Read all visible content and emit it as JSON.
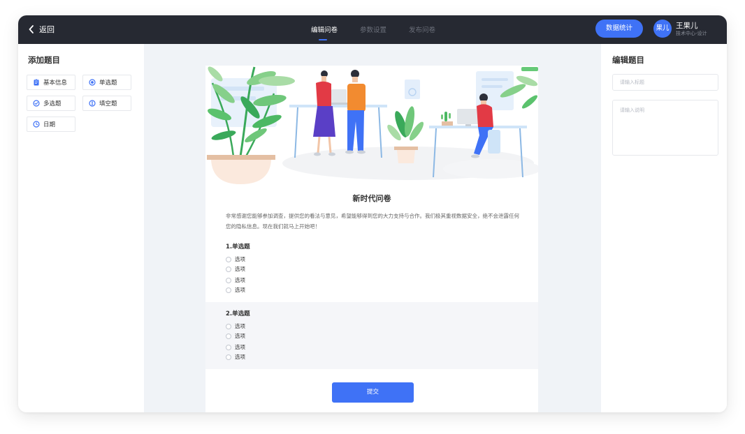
{
  "topbar": {
    "back_label": "返回",
    "tabs": [
      {
        "label": "编辑问卷",
        "active": true
      },
      {
        "label": "参数设置",
        "active": false
      },
      {
        "label": "发布问卷",
        "active": false
      }
    ],
    "stats_button": "数据统计",
    "user": {
      "avatar_text": "果儿",
      "name": "王果儿",
      "dept": "技术中心-设计"
    }
  },
  "left_panel": {
    "title": "添加题目",
    "items": [
      {
        "label": "基本信息",
        "icon": "clipboard-icon"
      },
      {
        "label": "单选题",
        "icon": "radio-icon"
      },
      {
        "label": "多选题",
        "icon": "check-circle-icon"
      },
      {
        "label": "填空题",
        "icon": "text-input-icon"
      },
      {
        "label": "日期",
        "icon": "clock-icon"
      }
    ]
  },
  "survey": {
    "title": "新时代问卷",
    "description": "非常感谢您能够参加调查，提供您的看法与意见，希望能够得到您的大力支持与合作。我们极其重视数据安全，绝不会泄露任何您的隐私信息。现在我们就马上开始吧！",
    "questions": [
      {
        "title": "1.单选题",
        "options": [
          "选项",
          "选项",
          "选项",
          "选项"
        ]
      },
      {
        "title": "2.单选题",
        "options": [
          "选项",
          "选项",
          "选项",
          "选项"
        ]
      }
    ],
    "submit_label": "提交"
  },
  "right_panel": {
    "title": "编辑题目",
    "title_placeholder": "请输入标题",
    "desc_placeholder": "请输入说明"
  },
  "colors": {
    "accent": "#3f72f6",
    "topbar": "#262932",
    "canvas": "#f0f3f7",
    "plant_green": "#5cc96b",
    "person_red": "#e23a45",
    "person_orange": "#f28b30"
  }
}
